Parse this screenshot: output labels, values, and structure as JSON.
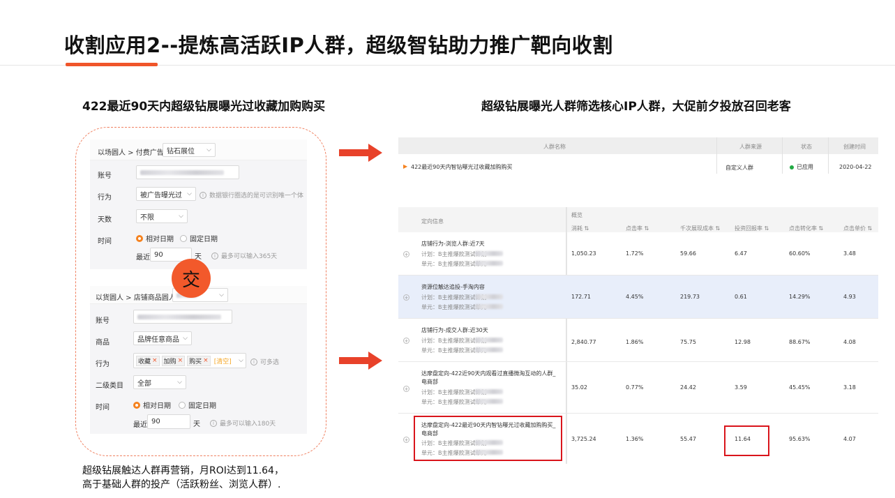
{
  "title": {
    "prefix": "收割应用2",
    "rest": "--提炼高活跃IP人群，超级智钻助力推广靶向收割"
  },
  "left_heading": "422最近90天内超级钻展曝光过收藏加购购买",
  "right_heading": "超级钻展曝光人群筛选核心IP人群，大促前夕投放召回老客",
  "form1": {
    "crumb": "以场圆人 > 付费广告",
    "crumb_select": "钻石展位",
    "account_label": "账号",
    "behavior_label": "行为",
    "behavior_value": "被广告曝光过",
    "behavior_hint": "数据银行圈选的是可识别唯一个体",
    "days_label": "天数",
    "days_value": "不限",
    "time_label": "时间",
    "opt_relative": "相对日期",
    "opt_fixed": "固定日期",
    "recent_label": "最近",
    "recent_value": "90",
    "day_unit": "天",
    "max_hint": "最多可以输入365天"
  },
  "jiao": "交",
  "form2": {
    "crumb": "以货圆人 > 店铺商品圆人",
    "account_label": "账号",
    "goods_label": "商品",
    "goods_value": "品牌任意商品",
    "behavior_label": "行为",
    "tags": [
      "收藏",
      "加购",
      "购买"
    ],
    "clear": "[清空]",
    "multi_hint": "可多选",
    "category_label": "二级类目",
    "category_value": "全部",
    "time_label": "时间",
    "opt_relative": "相对日期",
    "opt_fixed": "固定日期",
    "recent_label": "最近",
    "recent_value": "90",
    "day_unit": "天",
    "max_hint": "最多可以输入180天"
  },
  "crowd_table": {
    "headers": [
      "人群名称",
      "人群来源",
      "状态",
      "创建时间"
    ],
    "row": {
      "name": "422最近90天内智钻曝光过收藏加购购买",
      "source": "自定义人群",
      "status": "已应用",
      "date": "2020-04-22"
    }
  },
  "metrics_table": {
    "targeting_header": "定向信息",
    "overview_header": "概览",
    "headers": [
      "消耗 ⇅",
      "点击率 ⇅",
      "千次展现成本 ⇅",
      "投资回报率 ⇅",
      "点击转化率 ⇅",
      "点击单价 ⇅"
    ],
    "plan_prefix": "计划：B主推爆款测试计划",
    "unit_prefix": "单元：B主推爆款测试单元",
    "rows": [
      {
        "name1": "店铺行为-浏览人群:近7天",
        "name2": "",
        "values": [
          "1,050.23",
          "1.72%",
          "59.66",
          "6.47",
          "60.60%",
          "3.48"
        ]
      },
      {
        "name1": "资源位触达追投-手淘内容",
        "name2": "",
        "values": [
          "172.71",
          "4.45%",
          "219.73",
          "0.61",
          "14.29%",
          "4.93"
        ]
      },
      {
        "name1": "店铺行为-成交人群:近30天",
        "name2": "",
        "values": [
          "2,840.77",
          "1.86%",
          "75.75",
          "12.98",
          "88.67%",
          "4.08"
        ]
      },
      {
        "name1": "达摩盘定向-422近90天内观看过直播微淘互动的人群_",
        "name2": "电商部",
        "values": [
          "35.02",
          "0.77%",
          "24.42",
          "3.59",
          "45.45%",
          "3.18"
        ]
      },
      {
        "name1": "达摩盘定向-422最近90天内智钻曝光过收藏加购购买_",
        "name2": "电商部",
        "values": [
          "3,725.24",
          "1.36%",
          "55.47",
          "11.64",
          "95.63%",
          "4.07"
        ]
      }
    ]
  },
  "note": {
    "line1": "超级钻展触达人群再营销，月ROI达到11.64，",
    "line2": "高于基础人群的投产（活跃粉丝、浏览人群）."
  },
  "colors": {
    "accent": "#f0552a",
    "highlight": "#d9141b",
    "selected_row": "#e8eefa",
    "status_green": "#22aa44"
  }
}
